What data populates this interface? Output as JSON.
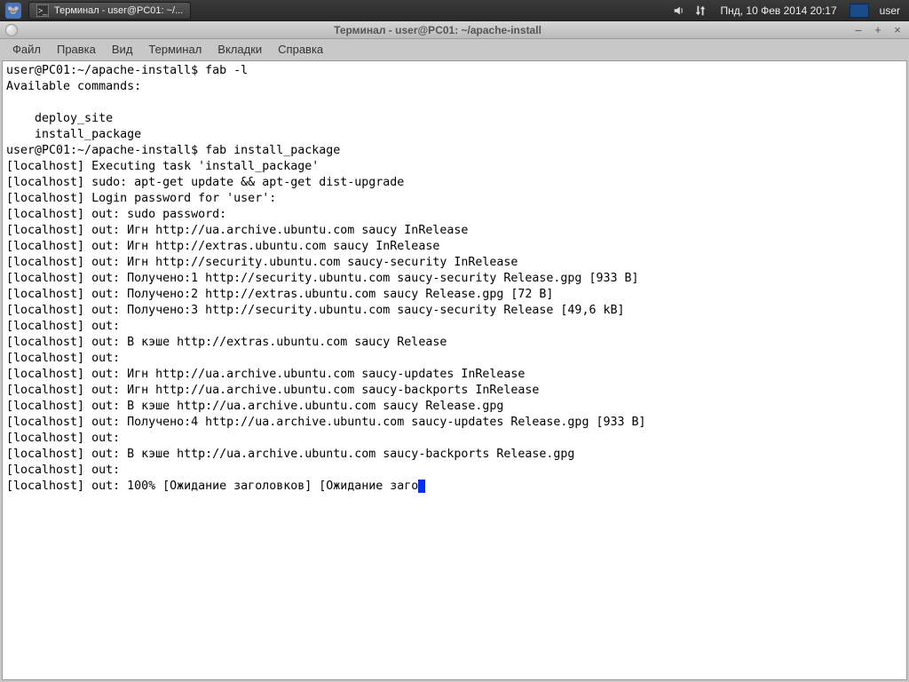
{
  "panel": {
    "taskbar_label": "Терминал - user@PC01: ~/...",
    "clock": "Пнд, 10 Фев 2014 20:17",
    "user": "user"
  },
  "window": {
    "title": "Терминал - user@PC01: ~/apache-install"
  },
  "menubar": {
    "file": "Файл",
    "edit": "Правка",
    "view": "Вид",
    "terminal": "Терминал",
    "tabs": "Вкладки",
    "help": "Справка"
  },
  "terminal": {
    "lines": [
      "user@PC01:~/apache-install$ fab -l",
      "Available commands:",
      "",
      "    deploy_site",
      "    install_package",
      "user@PC01:~/apache-install$ fab install_package",
      "[localhost] Executing task 'install_package'",
      "[localhost] sudo: apt-get update && apt-get dist-upgrade",
      "[localhost] Login password for 'user':",
      "[localhost] out: sudo password:",
      "[localhost] out: Игн http://ua.archive.ubuntu.com saucy InRelease",
      "[localhost] out: Игн http://extras.ubuntu.com saucy InRelease",
      "[localhost] out: Игн http://security.ubuntu.com saucy-security InRelease",
      "[localhost] out: Получено:1 http://security.ubuntu.com saucy-security Release.gpg [933 B]",
      "[localhost] out: Получено:2 http://extras.ubuntu.com saucy Release.gpg [72 B]",
      "[localhost] out: Получено:3 http://security.ubuntu.com saucy-security Release [49,6 kB]",
      "[localhost] out:",
      "[localhost] out: В кэше http://extras.ubuntu.com saucy Release",
      "[localhost] out:",
      "[localhost] out: Игн http://ua.archive.ubuntu.com saucy-updates InRelease",
      "[localhost] out: Игн http://ua.archive.ubuntu.com saucy-backports InRelease",
      "[localhost] out: В кэше http://ua.archive.ubuntu.com saucy Release.gpg",
      "[localhost] out: Получено:4 http://ua.archive.ubuntu.com saucy-updates Release.gpg [933 B]",
      "[localhost] out:",
      "[localhost] out: В кэше http://ua.archive.ubuntu.com saucy-backports Release.gpg",
      "[localhost] out:",
      "[localhost] out: 100% [Ожидание заголовков] [Ожидание заго"
    ]
  }
}
